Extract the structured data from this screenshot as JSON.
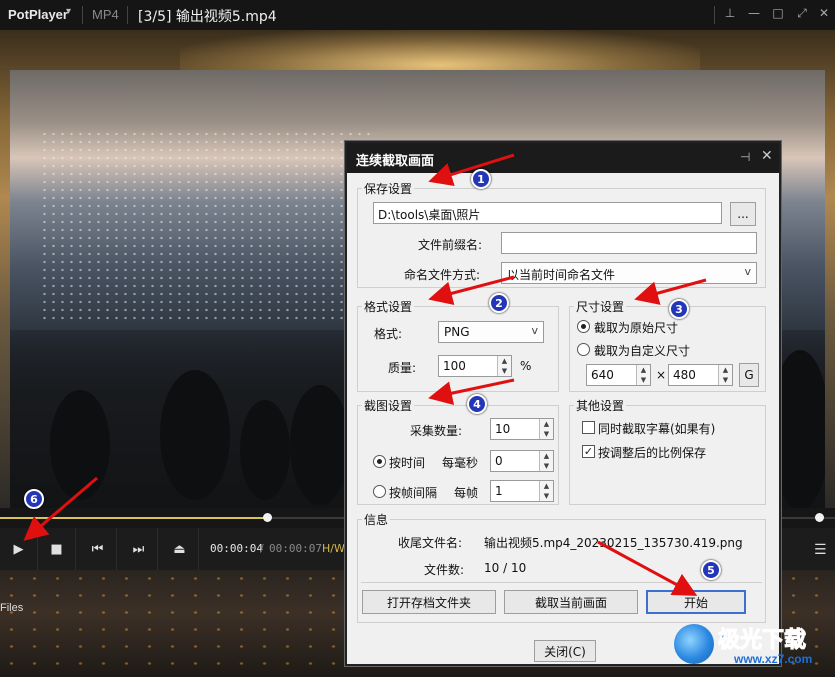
{
  "player": {
    "app_name": "PotPlayer",
    "format": "MP4",
    "title": "[3/5] 输出视频5.mp4",
    "time_current": "00:00:04",
    "time_sep": "/",
    "time_total": "00:00:07",
    "hw_label": "H/W",
    "progress_fraction": 0.32,
    "side_label": "Files"
  },
  "dialog": {
    "title": "连续截取画面",
    "save": {
      "group_label": "保存设置",
      "path_value": "D:\\tools\\桌面\\照片",
      "browse_label": "...",
      "prefix_label": "文件前缀名:",
      "prefix_value": "",
      "naming_label": "命名文件方式:",
      "naming_value": "以当前时间命名文件"
    },
    "format": {
      "group_label": "格式设置",
      "format_label": "格式:",
      "format_value": "PNG",
      "quality_label": "质量:",
      "quality_value": "100",
      "quality_unit": "%"
    },
    "size": {
      "group_label": "尺寸设置",
      "original_label": "截取为原始尺寸",
      "custom_label": "截取为自定义尺寸",
      "width_value": "640",
      "times": "×",
      "height_value": "480",
      "g_label": "G"
    },
    "capture": {
      "group_label": "截图设置",
      "count_label": "采集数量:",
      "count_value": "10",
      "by_time_label": "按时间",
      "per_ms_label": "每毫秒",
      "ms_value": "0",
      "by_frame_label": "按帧间隔",
      "per_frame_label": "每帧",
      "frame_value": "1"
    },
    "other": {
      "group_label": "其他设置",
      "subtitle_label": "同时截取字幕(如果有)",
      "ratio_label": "按调整后的比例保存"
    },
    "info": {
      "group_label": "信息",
      "last_file_label": "收尾文件名:",
      "last_file_value": "输出视频5.mp4_20230215_135730.419.png",
      "count_label": "文件数:",
      "count_value": "10 / 10"
    },
    "buttons": {
      "open_folder": "打开存档文件夹",
      "capture_now": "截取当前画面",
      "start": "开始",
      "close": "关闭(C)"
    }
  },
  "annotations": {
    "b1": "1",
    "b2": "2",
    "b3": "3",
    "b4": "4",
    "b5": "5",
    "b6": "6",
    "arrow_color": "#e01010",
    "badge_color": "#2436b8"
  },
  "watermark": {
    "text": "极光下载",
    "url": "www.xz7.com"
  },
  "icons": {
    "play": "play-icon",
    "stop": "stop-icon",
    "prev": "prev-icon",
    "next": "next-icon",
    "eject": "eject-icon",
    "menu": "menu-icon",
    "pin": "pin-icon",
    "close": "close-icon"
  }
}
